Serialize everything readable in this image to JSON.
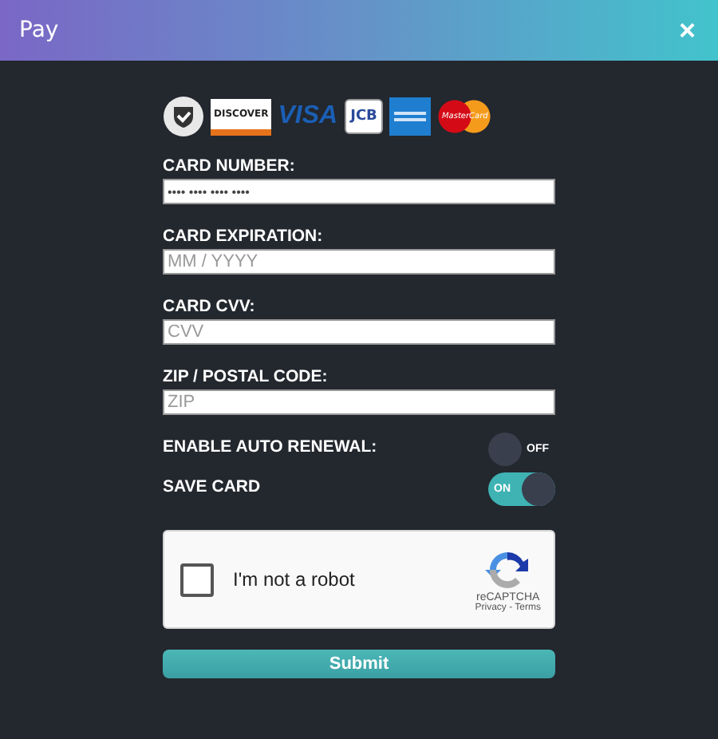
{
  "window": {
    "title": "Pay",
    "close": "×"
  },
  "card_logos": [
    {
      "kind": "shield"
    },
    {
      "kind": "discover",
      "text": "DISCOVER"
    },
    {
      "kind": "visa",
      "text": "VISA"
    },
    {
      "kind": "jcb",
      "text": "JCB"
    },
    {
      "kind": "amex"
    },
    {
      "kind": "mastercard",
      "text": "MasterCard"
    }
  ],
  "fields": [
    {
      "label": "CARD NUMBER:",
      "placeholder": "•••• •••• •••• ••••"
    },
    {
      "label": "CARD EXPIRATION:",
      "placeholder": "MM / YYYY"
    },
    {
      "label": "CARD CVV:",
      "placeholder": "CVV"
    },
    {
      "label": "ZIP / POSTAL CODE:",
      "placeholder": "ZIP"
    }
  ],
  "toggles": [
    {
      "label": "ENABLE AUTO RENEWAL:",
      "on": false,
      "state_text": "OFF"
    },
    {
      "label": "SAVE CARD",
      "on": true,
      "state_text": "ON"
    }
  ],
  "captcha": {
    "checked": false,
    "label": "I'm not a robot",
    "brand": "reCAPTCHA",
    "links": "Privacy - Terms"
  },
  "submit": "Submit"
}
